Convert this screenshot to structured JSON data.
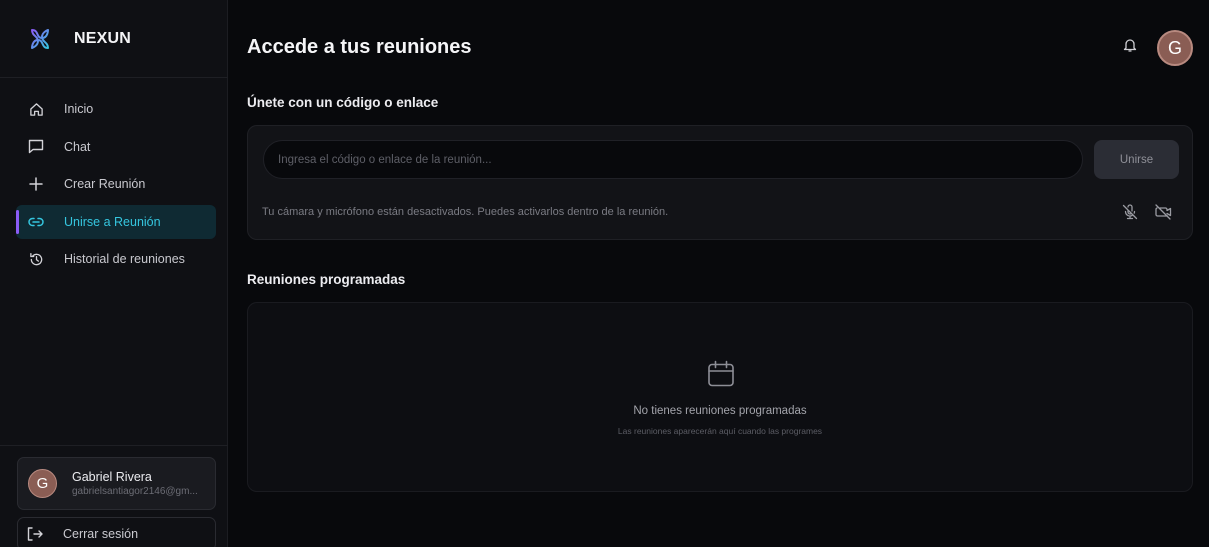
{
  "brand": {
    "name": "NEXUN",
    "icon": "nexun-logo-icon",
    "accent": "#8b5cf6"
  },
  "sidebar": {
    "items": [
      {
        "label": "Inicio",
        "icon": "home-icon",
        "active": false
      },
      {
        "label": "Chat",
        "icon": "chat-icon",
        "active": false
      },
      {
        "label": "Crear Reunión",
        "icon": "plus-icon",
        "active": false
      },
      {
        "label": "Unirse a Reunión",
        "icon": "link-icon",
        "active": true
      },
      {
        "label": "Historial de reuniones",
        "icon": "history-icon",
        "active": false
      }
    ],
    "active_color": "#35c6df"
  },
  "user": {
    "initial": "G",
    "name": "Gabriel Rivera",
    "email": "gabrielsantiagor2146@gm..."
  },
  "logout": {
    "label": "Cerrar sesión",
    "icon": "logout-icon"
  },
  "header": {
    "title": "Accede a tus reuniones",
    "avatar_initial": "G",
    "bell_icon": "bell-icon"
  },
  "join": {
    "section_title": "Únete con un código o enlace",
    "input_value": "",
    "input_placeholder": "Ingresa el código o enlace de la reunión...",
    "button_label": "Unirse",
    "note": "Tu cámara y micrófono están desactivados. Puedes activarlos dentro de la reunión.",
    "mic_icon": "mic-off-icon",
    "camera_icon": "camera-off-icon"
  },
  "scheduled": {
    "section_title": "Reuniones programadas",
    "empty_icon": "calendar-icon",
    "empty_title": "No tienes reuniones programadas",
    "empty_subtitle": "Las reuniones aparecerán aquí cuando las programes"
  }
}
